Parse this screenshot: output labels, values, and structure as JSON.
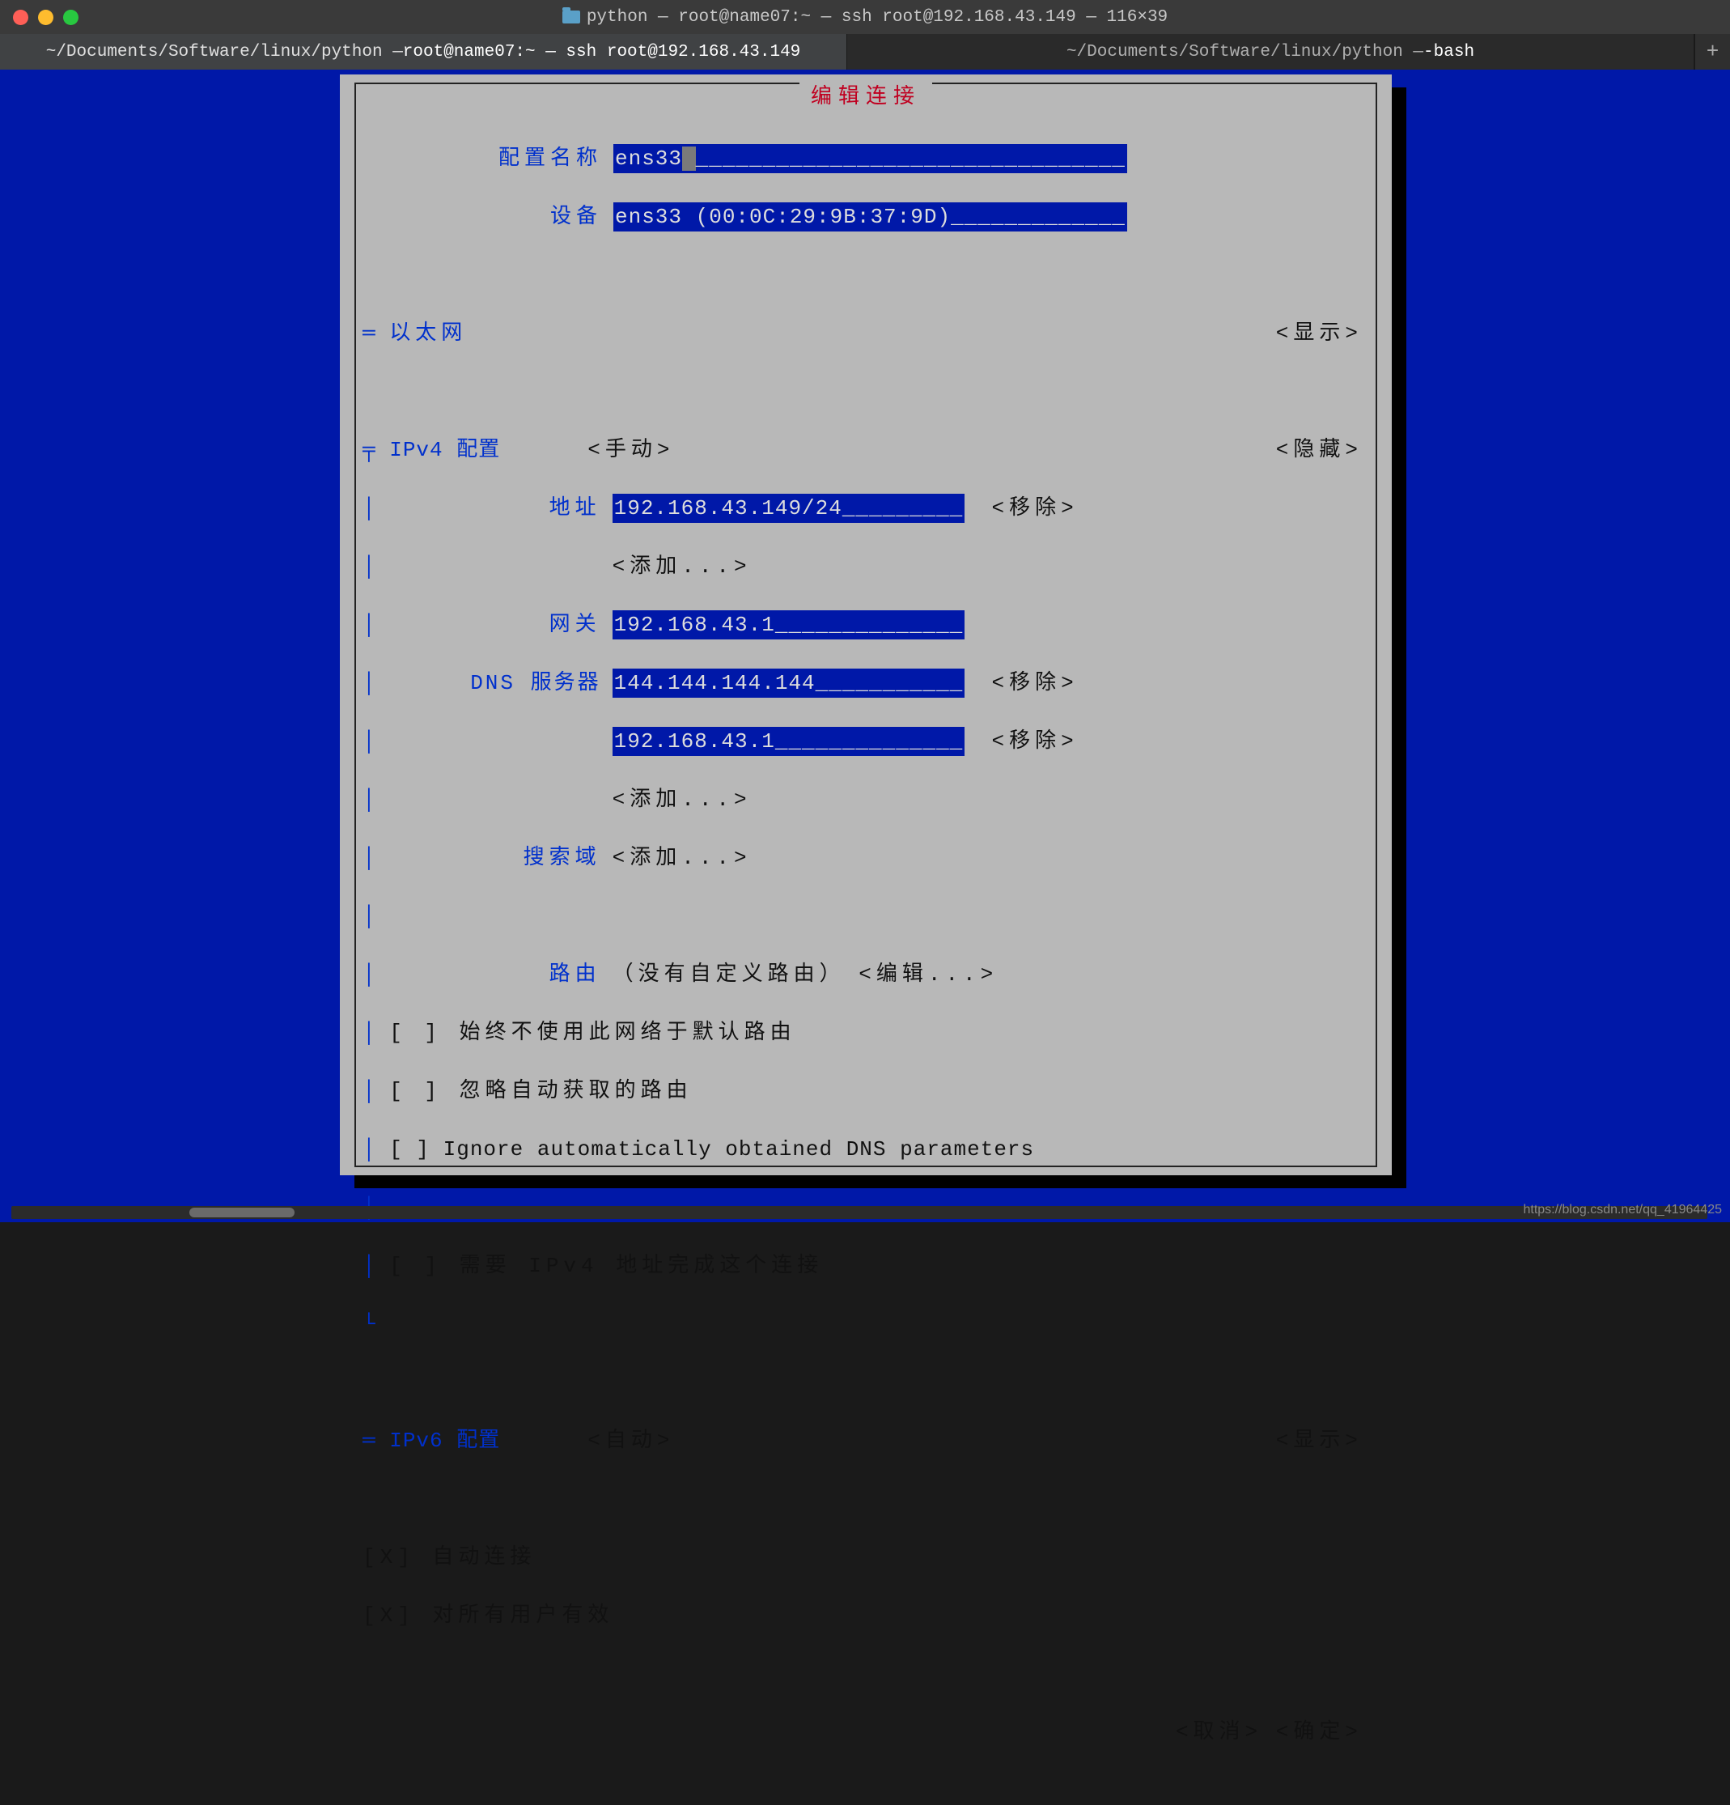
{
  "window": {
    "title": "python — root@name07:~ — ssh root@192.168.43.149 — 116×39"
  },
  "tabs": {
    "t0_prefix": "~/Documents/Software/linux/python — ",
    "t0_bold": "root@name07:~ — ssh root@192.168.43.149",
    "t1_prefix": "~/Documents/Software/linux/python — ",
    "t1_bold": "-bash",
    "add": "+"
  },
  "dialog": {
    "title": "编辑连接",
    "profile_label": "配置名称",
    "profile_value": "ens33",
    "profile_pad": "________________________________",
    "device_label": "设备",
    "device_value": "ens33 (00:0C:29:9B:37:9D)",
    "device_pad": "_____________",
    "ethernet_header": "以太网",
    "show_btn": "<显示>",
    "hide_btn": "<隐藏>",
    "ipv4_header": "IPv4 配置",
    "ipv4_mode": "<手动>",
    "addr_label": "地址",
    "addr_value": "192.168.43.149/24",
    "addr_pad": "_________",
    "remove_btn": "<移除>",
    "add_btn": "<添加...>",
    "gw_label": "网关",
    "gw_value": "192.168.43.1",
    "gw_pad": "______________",
    "dns_label": "DNS 服务器",
    "dns1_value": "144.144.144.144",
    "dns1_pad": "___________",
    "dns2_value": "192.168.43.1",
    "dns2_pad": "______________",
    "search_label": "搜索域",
    "route_label": "路由",
    "route_none": "（没有自定义路由）",
    "edit_btn": "<编辑...>",
    "cb1": "[ ] 始终不使用此网络于默认路由",
    "cb2": "[ ] 忽略自动获取的路由",
    "cb3": "[ ] Ignore automatically obtained DNS parameters",
    "cb4": "[ ] 需要 IPv4 地址完成这个连接",
    "ipv6_header": "IPv6 配置",
    "ipv6_mode": "<自动>",
    "cb5": "[X] 自动连接",
    "cb6": "[X] 对所有用户有效",
    "cancel_btn": "<取消>",
    "ok_btn": "<确定>"
  },
  "watermark": "https://blog.csdn.net/qq_41964425"
}
